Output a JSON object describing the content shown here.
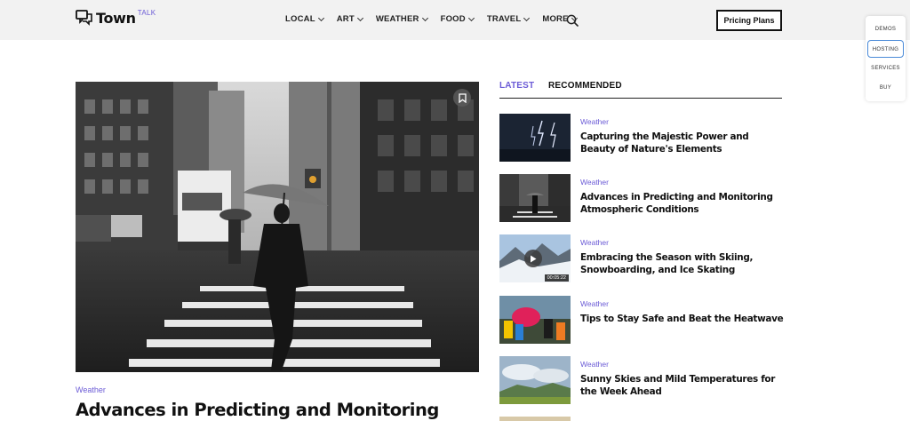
{
  "brand": {
    "name": "Town",
    "sup": "TALK",
    "accent": "#6b5bd6"
  },
  "nav": [
    {
      "label": "LOCAL"
    },
    {
      "label": "ART"
    },
    {
      "label": "WEATHER"
    },
    {
      "label": "FOOD"
    },
    {
      "label": "TRAVEL"
    },
    {
      "label": "MORE"
    }
  ],
  "header": {
    "pricing_label": "Pricing Plans",
    "search_icon": "search-icon"
  },
  "side_menu": [
    "DEMOS",
    "HOSTING",
    "SERVICES",
    "BUY"
  ],
  "hero": {
    "category": "Weather",
    "title": "Advances in Predicting and Monitoring",
    "bookmark_icon": "bookmark-icon"
  },
  "tabs": {
    "latest": "LATEST",
    "recommended": "RECOMMENDED"
  },
  "articles": [
    {
      "category": "Weather",
      "title": "Capturing the Majestic Power and Beauty of Nature's Elements"
    },
    {
      "category": "Weather",
      "title": "Advances in Predicting and Monitoring Atmospheric Conditions"
    },
    {
      "category": "Weather",
      "title": "Embracing the Season with Skiing, Snowboarding, and Ice Skating",
      "duration": "00:05:22"
    },
    {
      "category": "Weather",
      "title": "Tips to Stay Safe and Beat the Heatwave"
    },
    {
      "category": "Weather",
      "title": "Sunny Skies and Mild Temperatures for the Week Ahead"
    }
  ]
}
